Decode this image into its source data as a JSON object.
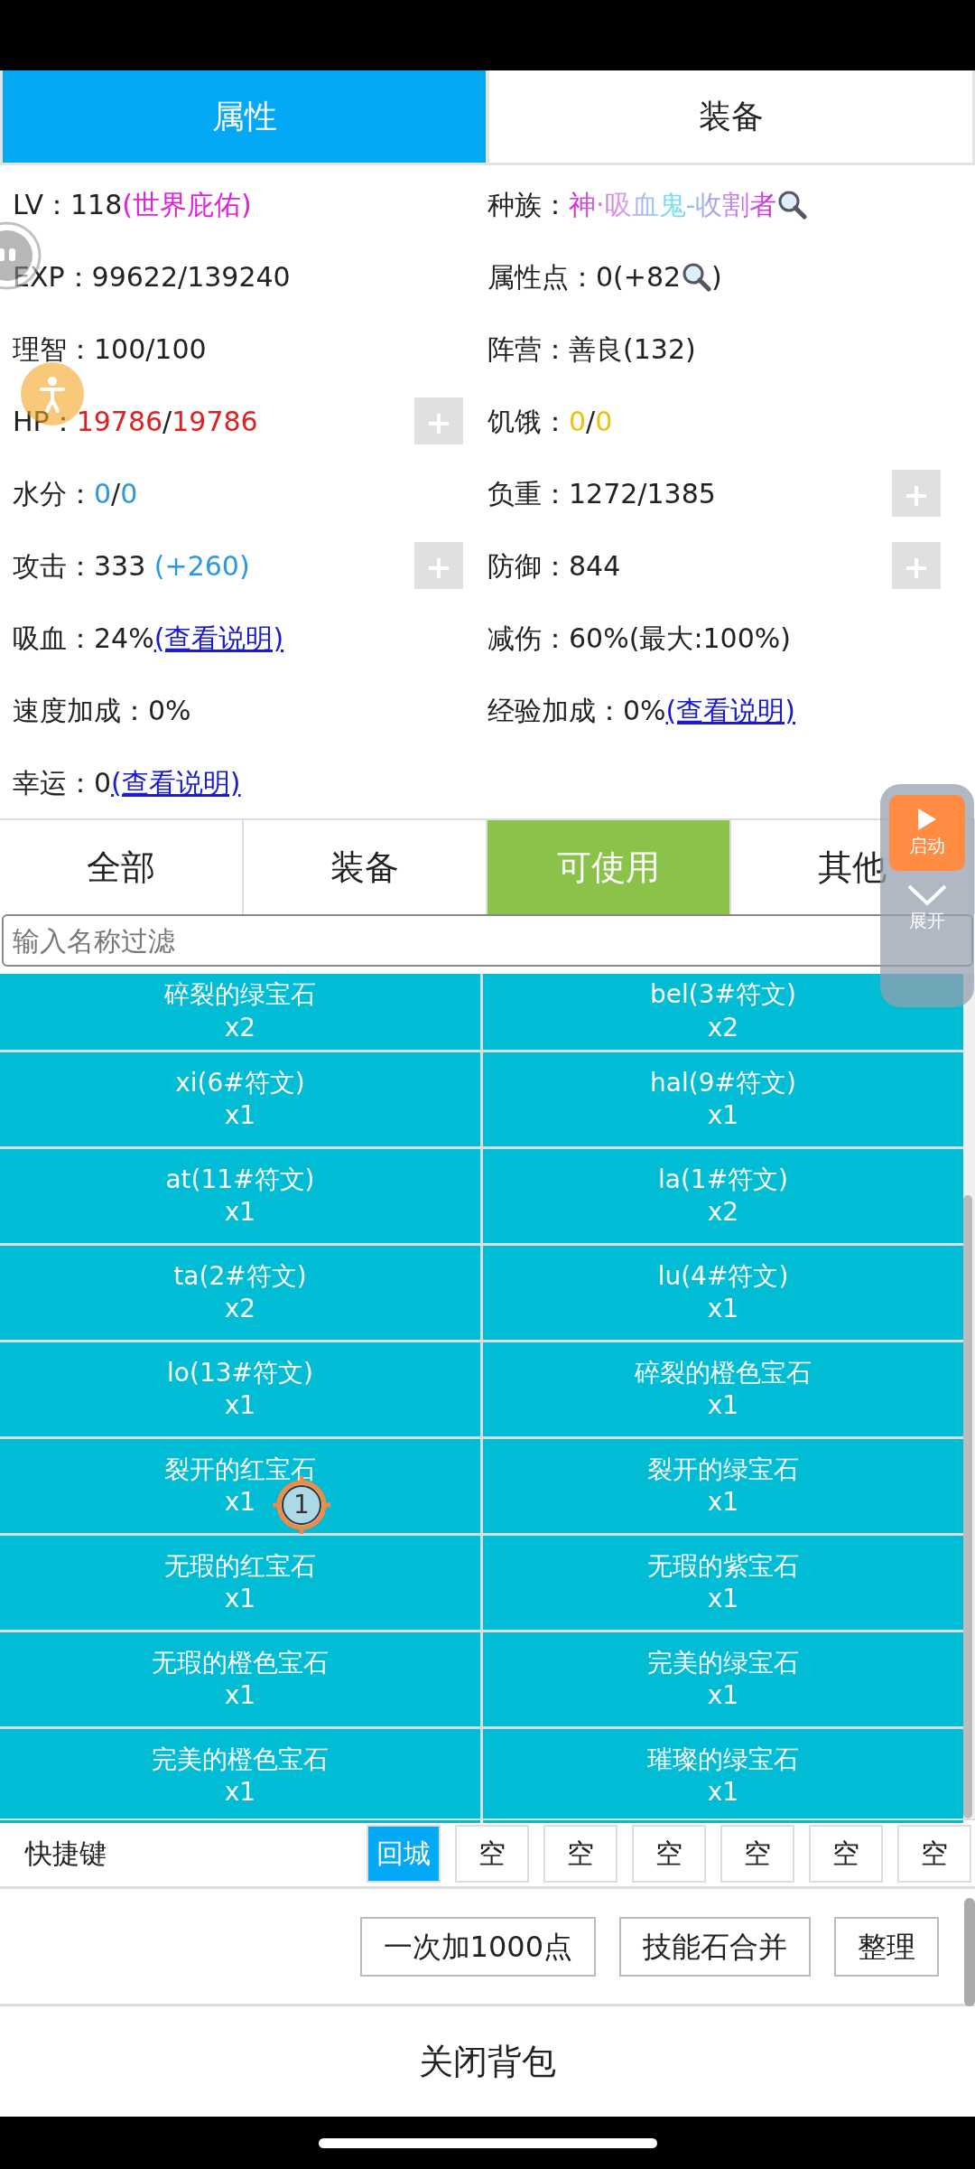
{
  "tabs": [
    {
      "label": "属性",
      "selected": true
    },
    {
      "label": "装备",
      "selected": false
    }
  ],
  "stat_rows": [
    {
      "left": {
        "label": "LV：",
        "parts": [
          {
            "kind": "plain",
            "text": "118"
          },
          {
            "kind": "colored",
            "text": "(世界庇佑)",
            "color": "#e020d8"
          }
        ],
        "has_add_button": false
      },
      "right": {
        "label": "种族：",
        "parts": [
          {
            "kind": "gradient",
            "text": "神·吸血鬼-收割者"
          },
          {
            "kind": "search"
          }
        ],
        "has_add_button": false
      }
    },
    {
      "left": {
        "label": "EXP：",
        "parts": [
          {
            "kind": "plain",
            "text": "99622/139240"
          }
        ],
        "has_add_button": false
      },
      "right": {
        "label": "属性点：",
        "parts": [
          {
            "kind": "plain",
            "text": "0(+82"
          },
          {
            "kind": "search"
          },
          {
            "kind": "plain",
            "text": ")"
          }
        ],
        "has_add_button": false
      }
    },
    {
      "left": {
        "label": "理智：",
        "parts": [
          {
            "kind": "plain",
            "text": "100/100"
          }
        ],
        "has_add_button": false
      },
      "right": {
        "label": "阵营：",
        "parts": [
          {
            "kind": "plain",
            "text": "善良(132)"
          }
        ],
        "has_add_button": false
      }
    },
    {
      "left": {
        "label": "HP：",
        "parts": [
          {
            "kind": "colored",
            "text": "19786",
            "color": "#e02020"
          },
          {
            "kind": "plain",
            "text": "/"
          },
          {
            "kind": "colored",
            "text": "19786",
            "color": "#e02020"
          }
        ],
        "has_add_button": true
      },
      "right": {
        "label": "饥饿：",
        "parts": [
          {
            "kind": "colored",
            "text": "0",
            "color": "#f0c010"
          },
          {
            "kind": "plain",
            "text": "/"
          },
          {
            "kind": "colored",
            "text": "0",
            "color": "#f0c010"
          }
        ],
        "has_add_button": false
      }
    },
    {
      "left": {
        "label": "水分：",
        "parts": [
          {
            "kind": "colored",
            "text": "0",
            "color": "#2a98e0"
          },
          {
            "kind": "plain",
            "text": "/"
          },
          {
            "kind": "colored",
            "text": "0",
            "color": "#2a98e0"
          }
        ],
        "has_add_button": false
      },
      "right": {
        "label": "负重：",
        "parts": [
          {
            "kind": "plain",
            "text": "1272/1385"
          }
        ],
        "has_add_button": true
      }
    },
    {
      "left": {
        "label": "攻击：",
        "parts": [
          {
            "kind": "plain",
            "text": "333 "
          },
          {
            "kind": "colored",
            "text": "(+260)",
            "color": "#2a98e0"
          }
        ],
        "has_add_button": true
      },
      "right": {
        "label": "防御：",
        "parts": [
          {
            "kind": "plain",
            "text": "844"
          }
        ],
        "has_add_button": true
      }
    },
    {
      "left": {
        "label": "吸血：",
        "parts": [
          {
            "kind": "plain",
            "text": "24%"
          },
          {
            "kind": "link",
            "text": "(查看说明)"
          }
        ],
        "has_add_button": false
      },
      "right": {
        "label": "减伤：",
        "parts": [
          {
            "kind": "plain",
            "text": "60%(最大:100%)"
          }
        ],
        "has_add_button": false
      }
    },
    {
      "left": {
        "label": "速度加成：",
        "parts": [
          {
            "kind": "plain",
            "text": "0%"
          }
        ],
        "has_add_button": false
      },
      "right": {
        "label": "经验加成：",
        "parts": [
          {
            "kind": "plain",
            "text": "0%"
          },
          {
            "kind": "link",
            "text": "(查看说明)"
          }
        ],
        "has_add_button": false
      }
    },
    {
      "left": {
        "label": "幸运：",
        "parts": [
          {
            "kind": "plain",
            "text": "0"
          },
          {
            "kind": "link",
            "text": "(查看说明)"
          }
        ],
        "has_add_button": false
      }
    }
  ],
  "categories": [
    {
      "label": "全部",
      "selected": false
    },
    {
      "label": "装备",
      "selected": false
    },
    {
      "label": "可使用",
      "selected": true
    },
    {
      "label": "其他",
      "selected": false
    }
  ],
  "filter": {
    "placeholder": "输入名称过滤"
  },
  "items": [
    {
      "name": "碎裂的绿宝石",
      "count": "x2"
    },
    {
      "name": "bel(3#符文)",
      "count": "x2"
    },
    {
      "name": "xi(6#符文)",
      "count": "x1"
    },
    {
      "name": "hal(9#符文)",
      "count": "x1"
    },
    {
      "name": "at(11#符文)",
      "count": "x1"
    },
    {
      "name": "la(1#符文)",
      "count": "x2"
    },
    {
      "name": "ta(2#符文)",
      "count": "x2"
    },
    {
      "name": "lu(4#符文)",
      "count": "x1"
    },
    {
      "name": "lo(13#符文)",
      "count": "x1"
    },
    {
      "name": "碎裂的橙色宝石",
      "count": "x1"
    },
    {
      "name": "裂开的红宝石",
      "count": "x1"
    },
    {
      "name": "裂开的绿宝石",
      "count": "x1"
    },
    {
      "name": "无瑕的红宝石",
      "count": "x1"
    },
    {
      "name": "无瑕的紫宝石",
      "count": "x1"
    },
    {
      "name": "无瑕的橙色宝石",
      "count": "x1"
    },
    {
      "name": "完美的绿宝石",
      "count": "x1"
    },
    {
      "name": "完美的橙色宝石",
      "count": "x1"
    },
    {
      "name": "璀璨的绿宝石",
      "count": "x1"
    }
  ],
  "shortcuts": {
    "label": "快捷键",
    "keys": [
      {
        "label": "回城",
        "selected": true
      },
      {
        "label": "空",
        "selected": false
      },
      {
        "label": "空",
        "selected": false
      },
      {
        "label": "空",
        "selected": false
      },
      {
        "label": "空",
        "selected": false
      },
      {
        "label": "空",
        "selected": false
      },
      {
        "label": "空",
        "selected": false
      }
    ]
  },
  "actions": [
    "一次加1000点",
    "技能石合并",
    "整理"
  ],
  "close_label": "关闭背包",
  "floating_panel": {
    "launch_label": "启动",
    "expand_label": "展开"
  },
  "marker": {
    "label": "1"
  }
}
